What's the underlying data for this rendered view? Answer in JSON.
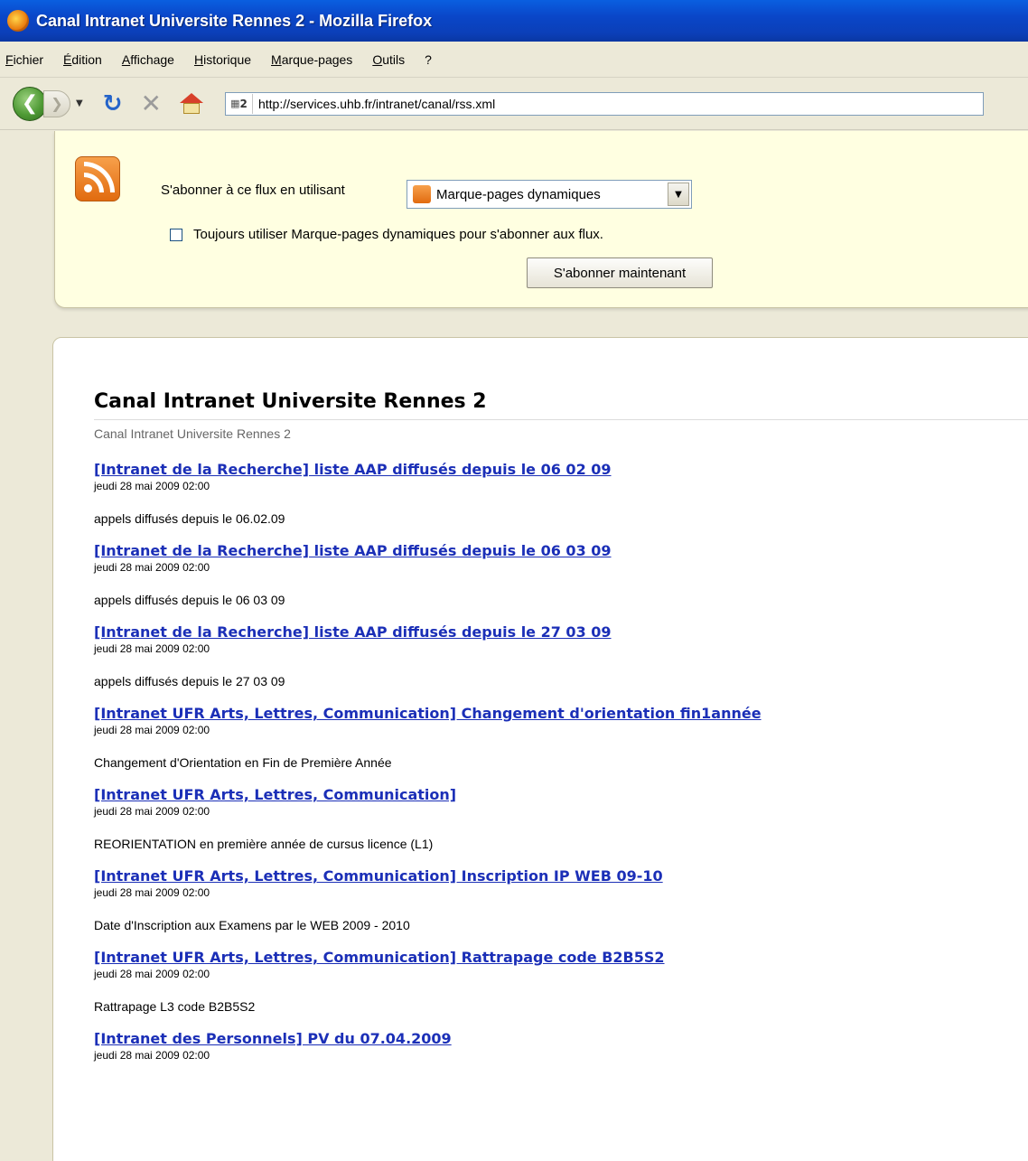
{
  "window": {
    "title": "Canal Intranet Universite Rennes 2 - Mozilla Firefox"
  },
  "menu": [
    "Fichier",
    "Édition",
    "Affichage",
    "Historique",
    "Marque-pages",
    "Outils",
    "?"
  ],
  "nav": {
    "url": "http://services.uhb.fr/intranet/canal/rss.xml",
    "site_icon_text": "2"
  },
  "subscribe": {
    "label": "S'abonner à ce flux en utilisant",
    "selected": "Marque-pages dynamiques",
    "always_label": "Toujours utiliser Marque-pages dynamiques pour s'abonner aux flux.",
    "always_checked": false,
    "button": "S'abonner maintenant"
  },
  "feed": {
    "title": "Canal Intranet Universite Rennes 2",
    "subtitle": "Canal Intranet Universite Rennes 2",
    "entries": [
      {
        "title": "[Intranet de la Recherche] liste AAP diffusés depuis le 06 02 09",
        "date": "jeudi 28 mai 2009 02:00",
        "desc": "appels diffusés depuis le 06.02.09"
      },
      {
        "title": "[Intranet de la Recherche] liste AAP diffusés depuis le 06 03 09",
        "date": "jeudi 28 mai 2009 02:00",
        "desc": "appels diffusés depuis le 06 03 09"
      },
      {
        "title": "[Intranet de la Recherche] liste AAP diffusés depuis le 27 03 09",
        "date": "jeudi 28 mai 2009 02:00",
        "desc": "appels diffusés depuis le 27 03 09"
      },
      {
        "title": "[Intranet UFR Arts, Lettres, Communication] Changement d'orientation fin1année",
        "date": "jeudi 28 mai 2009 02:00",
        "desc": "Changement d'Orientation en Fin de Première Année"
      },
      {
        "title": "[Intranet UFR Arts, Lettres, Communication]",
        "date": "jeudi 28 mai 2009 02:00",
        "desc": "REORIENTATION en première année de cursus licence (L1)"
      },
      {
        "title": "[Intranet UFR Arts, Lettres, Communication] Inscription IP WEB 09-10",
        "date": "jeudi 28 mai 2009 02:00",
        "desc": "Date d'Inscription aux Examens par le WEB 2009 - 2010"
      },
      {
        "title": "[Intranet UFR Arts, Lettres, Communication] Rattrapage code B2B5S2",
        "date": "jeudi 28 mai 2009 02:00",
        "desc": "Rattrapage L3 code B2B5S2"
      },
      {
        "title": "[Intranet des Personnels] PV du 07.04.2009",
        "date": "jeudi 28 mai 2009 02:00",
        "desc": ""
      }
    ]
  }
}
